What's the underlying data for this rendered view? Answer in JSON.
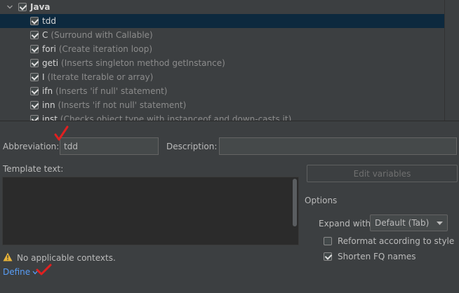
{
  "tree": {
    "group": {
      "label": "Java",
      "checked": true,
      "expanded": true
    },
    "items": [
      {
        "abbr": "tdd",
        "desc": "",
        "checked": true,
        "selected": true
      },
      {
        "abbr": "C",
        "desc": "(Surround with Callable)",
        "checked": true
      },
      {
        "abbr": "fori",
        "desc": "(Create iteration loop)",
        "checked": true
      },
      {
        "abbr": "geti",
        "desc": "(Inserts singleton method getInstance)",
        "checked": true
      },
      {
        "abbr": "I",
        "desc": "(Iterate Iterable or array)",
        "checked": true
      },
      {
        "abbr": "ifn",
        "desc": "(Inserts 'if null' statement)",
        "checked": true
      },
      {
        "abbr": "inn",
        "desc": "(Inserts 'if not null' statement)",
        "checked": true
      },
      {
        "abbr": "inst",
        "desc": "(Checks object type with instanceof and down-casts it)",
        "checked": true
      }
    ]
  },
  "form": {
    "abbreviation_label": "Abbreviation:",
    "abbreviation_value": "tdd",
    "description_label": "Description:",
    "description_value": "",
    "template_text_label": "Template text:",
    "template_text_value": "",
    "edit_variables_label": "Edit variables"
  },
  "options": {
    "title": "Options",
    "expand_with_label": "Expand with",
    "expand_with_value": "Default (Tab)",
    "reformat_label": "Reformat according to style",
    "reformat_checked": false,
    "shorten_label": "Shorten FQ names",
    "shorten_checked": true
  },
  "contexts": {
    "warning_text": "No applicable contexts.",
    "define_label": "Define"
  },
  "colors": {
    "background": "#3c3f41",
    "selection": "#0d293e",
    "link": "#589df6",
    "warning": "#e8b339",
    "annotation": "#e02020"
  },
  "icons": [
    "chevron-down-icon",
    "checkbox-icon",
    "warning-icon",
    "dropdown-arrow-icon"
  ]
}
